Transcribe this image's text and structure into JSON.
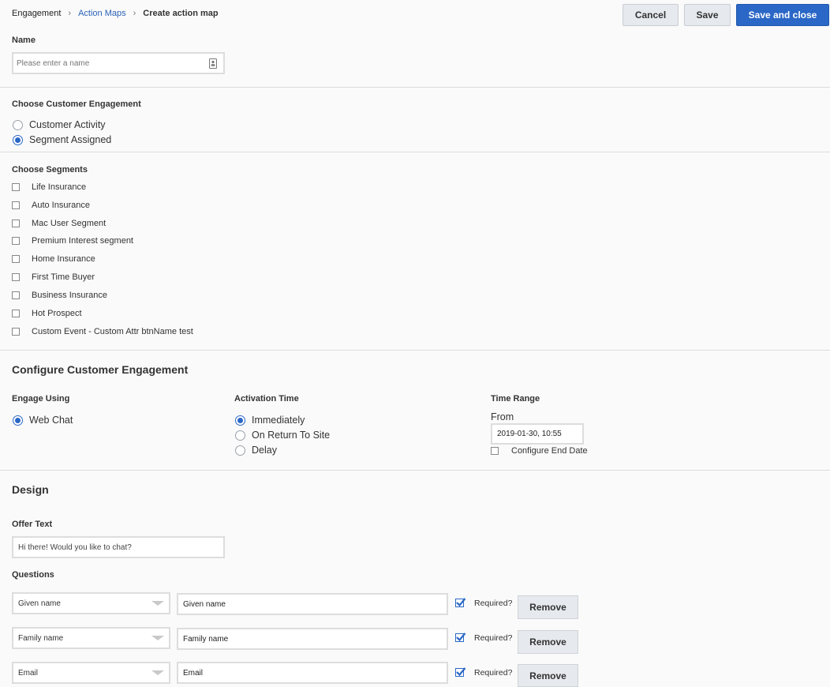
{
  "breadcrumb": {
    "items": [
      "Engagement",
      "Action Maps",
      "Create action map"
    ],
    "separator": "›"
  },
  "toolbar": {
    "cancel_label": "Cancel",
    "save_label": "Save",
    "save_close_label": "Save and close"
  },
  "name_section": {
    "label": "Name",
    "placeholder": "Please enter a name",
    "value": ""
  },
  "engagement_choice": {
    "label": "Choose Customer Engagement",
    "options": [
      {
        "label": "Customer Activity",
        "selected": false
      },
      {
        "label": "Segment Assigned",
        "selected": true
      }
    ]
  },
  "segments": {
    "label": "Choose Segments",
    "items": [
      "Life Insurance",
      "Auto Insurance",
      "Mac User Segment",
      "Premium Interest segment",
      "Home Insurance",
      "First Time Buyer",
      "Business Insurance",
      "Hot Prospect",
      "Custom Event - Custom Attr btnName test"
    ]
  },
  "configure": {
    "title": "Configure Customer Engagement",
    "engage_using": {
      "label": "Engage Using",
      "options": [
        {
          "label": "Web Chat",
          "selected": true
        }
      ]
    },
    "activation_time": {
      "label": "Activation Time",
      "options": [
        {
          "label": "Immediately",
          "selected": true
        },
        {
          "label": "On Return To Site",
          "selected": false
        },
        {
          "label": "Delay",
          "selected": false
        }
      ]
    },
    "time_range": {
      "label": "Time Range",
      "from_label": "From",
      "from_value": "2019-01-30, 10:55",
      "end_date_label": "Configure End Date"
    }
  },
  "design": {
    "title": "Design",
    "offer_text_label": "Offer Text",
    "offer_text_value": "Hi there! Would you like to chat?",
    "questions_label": "Questions",
    "questions": [
      {
        "type": "Given name",
        "label": "Given name",
        "required_label": "Required?",
        "remove_label": "Remove"
      },
      {
        "type": "Family name",
        "label": "Family name",
        "required_label": "Required?",
        "remove_label": "Remove"
      },
      {
        "type": "Email",
        "label": "Email",
        "required_label": "Required?",
        "remove_label": "Remove"
      }
    ]
  },
  "colors": {
    "accent": "#2a67c6",
    "link": "#2a62b8",
    "background": "#fafafa"
  }
}
